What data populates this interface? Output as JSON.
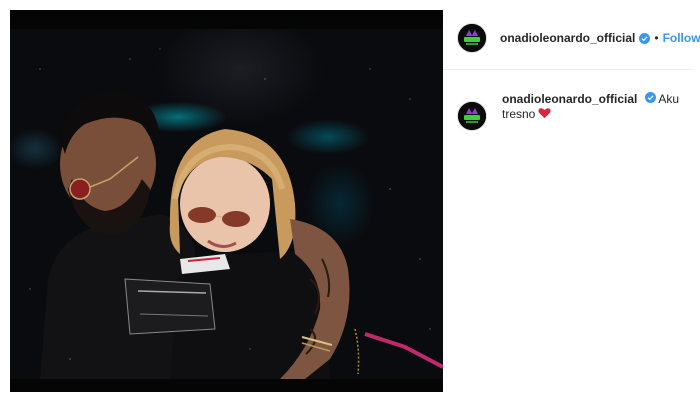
{
  "post": {
    "username": "onadioleonardo_official",
    "follow_label": "Follow",
    "separator": "•",
    "caption": "Aku tresno",
    "caption_emoji": "red-heart-icon",
    "verified_icon": "verified-badge-icon"
  },
  "colors": {
    "accent_blue": "#3897f0",
    "text": "#262626",
    "heart_red": "#d7263d",
    "photo_frame": "#050505"
  }
}
